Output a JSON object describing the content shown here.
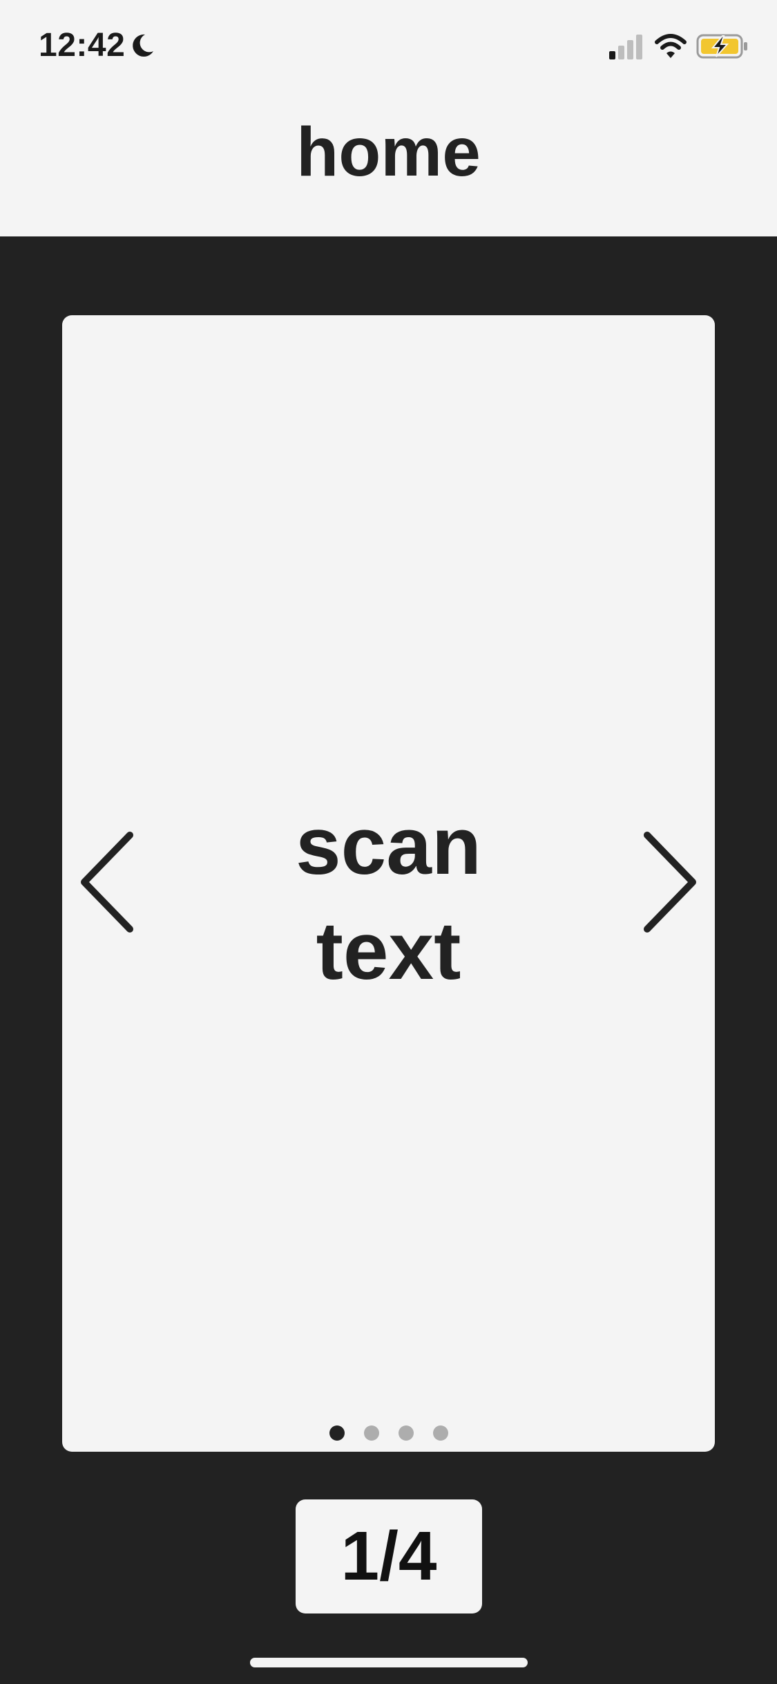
{
  "status_bar": {
    "time": "12:42",
    "icons": [
      "moon-icon",
      "cellular-signal-icon",
      "wifi-icon",
      "battery-charging-icon"
    ],
    "battery_color": "#f2c62f"
  },
  "header": {
    "title": "home"
  },
  "carousel": {
    "slide_title_line1": "scan",
    "slide_title_line2": "text",
    "prev_icon": "chevron-left-icon",
    "next_icon": "chevron-right-icon",
    "total_slides": 4,
    "current_slide": 1
  },
  "footer": {
    "page_counter": "1/4"
  },
  "colors": {
    "background": "#222222",
    "surface": "#f4f4f4",
    "text": "#222222",
    "dot_inactive": "#adadad"
  }
}
